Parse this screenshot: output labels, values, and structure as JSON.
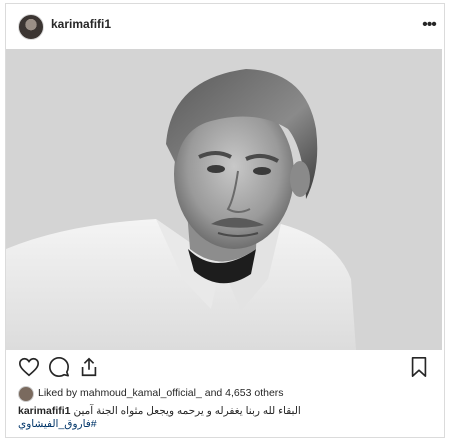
{
  "post": {
    "username": "karimafifi1",
    "more_label": "•••",
    "image_alt": "Black and white portrait of a man in a white shirt",
    "likes": {
      "text": "Liked by mahmoud_kamal_official_ and 4,653 others"
    },
    "caption": {
      "username": "karimafifi1",
      "text": "البقاء لله ربنا يغفرله و يرحمه ويجعل مثواه الجنة آمين",
      "hashtag": "#فاروق_الفيشاوي"
    }
  },
  "icons": {
    "like": "heart-icon",
    "comment": "comment-icon",
    "share": "share-icon",
    "save": "bookmark-icon",
    "more": "more-icon"
  }
}
